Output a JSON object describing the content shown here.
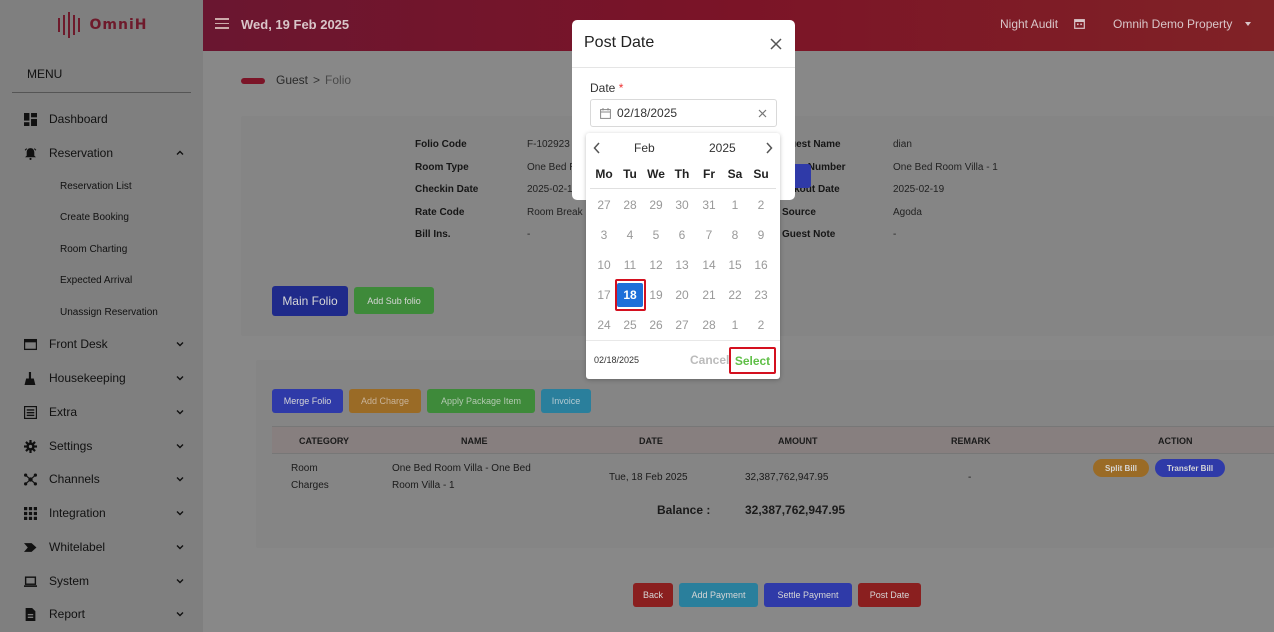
{
  "brand": {
    "name": "OmniH"
  },
  "sidebar": {
    "menu_title": "MENU",
    "items": [
      {
        "label": "Dashboard",
        "icon": "dashboard-icon"
      },
      {
        "label": "Reservation",
        "icon": "bell-icon",
        "expanded": true
      },
      {
        "label": "Front Desk",
        "icon": "window-icon"
      },
      {
        "label": "Housekeeping",
        "icon": "housekeeping-icon"
      },
      {
        "label": "Extra",
        "icon": "list-icon"
      },
      {
        "label": "Settings",
        "icon": "gear-icon"
      },
      {
        "label": "Channels",
        "icon": "network-icon"
      },
      {
        "label": "Integration",
        "icon": "grid-icon"
      },
      {
        "label": "Whitelabel",
        "icon": "tag-icon"
      },
      {
        "label": "System",
        "icon": "laptop-icon"
      },
      {
        "label": "Report",
        "icon": "report-icon"
      }
    ],
    "reservation_sub": [
      "Reservation List",
      "Create Booking",
      "Room Charting",
      "Expected Arrival",
      "Unassign Reservation"
    ]
  },
  "topbar": {
    "date": "Wed, 19 Feb 2025",
    "night_audit": "Night Audit",
    "property": "Omnih Demo Property"
  },
  "breadcrumb": {
    "parent": "Guest",
    "separator": ">",
    "current": "Folio"
  },
  "folio_info": {
    "left": [
      {
        "label": "Folio Code",
        "value": "F-102923"
      },
      {
        "label": "Room Type",
        "value": "One Bed Ro"
      },
      {
        "label": "Checkin Date",
        "value": "2025-02-1"
      },
      {
        "label": "Rate Code",
        "value": "Room Break"
      },
      {
        "label": "Bill Ins.",
        "value": "-"
      }
    ],
    "right": [
      {
        "label": "uest Name",
        "value": "dian"
      },
      {
        "label": "om Number",
        "value": "One Bed Room Villa - 1"
      },
      {
        "label": "eckout Date",
        "value": "2025-02-19"
      },
      {
        "label": "Source",
        "value": "Agoda"
      },
      {
        "label": "Guest Note",
        "value": "-"
      }
    ]
  },
  "folio_tabs": {
    "main": "Main Folio",
    "add_sub": "Add Sub folio"
  },
  "actions": {
    "merge": "Merge Folio",
    "add_charge": "Add Charge",
    "apply_package": "Apply Package Item",
    "invoice": "Invoice"
  },
  "table": {
    "headers": [
      "CATEGORY",
      "NAME",
      "DATE",
      "AMOUNT",
      "REMARK",
      "ACTION"
    ],
    "rows": [
      {
        "category_line1": "Room",
        "category_line2": "Charges",
        "name_line1": "One Bed Room Villa - One Bed",
        "name_line2": "Room Villa - 1",
        "date": "Tue, 18 Feb 2025",
        "amount": "32,387,762,947.95",
        "remark": "-",
        "split": "Split Bill",
        "transfer": "Transfer Bill"
      }
    ],
    "balance_label": "Balance :",
    "balance_value": "32,387,762,947.95"
  },
  "footer_buttons": {
    "back": "Back",
    "add_payment": "Add Payment",
    "settle_payment": "Settle Payment",
    "post_date": "Post Date"
  },
  "modal": {
    "title": "Post Date",
    "date_label": "Date",
    "required_mark": "*",
    "date_value": "02/18/2025"
  },
  "datepicker": {
    "month": "Feb",
    "year": "2025",
    "weekdays": [
      "Mo",
      "Tu",
      "We",
      "Th",
      "Fr",
      "Sa",
      "Su"
    ],
    "weeks": [
      [
        "27",
        "28",
        "29",
        "30",
        "31",
        "1",
        "2"
      ],
      [
        "3",
        "4",
        "5",
        "6",
        "7",
        "8",
        "9"
      ],
      [
        "10",
        "11",
        "12",
        "13",
        "14",
        "15",
        "16"
      ],
      [
        "17",
        "18",
        "19",
        "20",
        "21",
        "22",
        "23"
      ],
      [
        "24",
        "25",
        "26",
        "27",
        "28",
        "1",
        "2"
      ]
    ],
    "selected_day": "18",
    "footer_date": "02/18/2025",
    "cancel": "Cancel",
    "select": "Select"
  },
  "colors": {
    "accent_blue": "#1e6fd9",
    "select_green": "#5fbf47",
    "highlight_red": "#d4101f",
    "topbar": "#7b1427"
  }
}
